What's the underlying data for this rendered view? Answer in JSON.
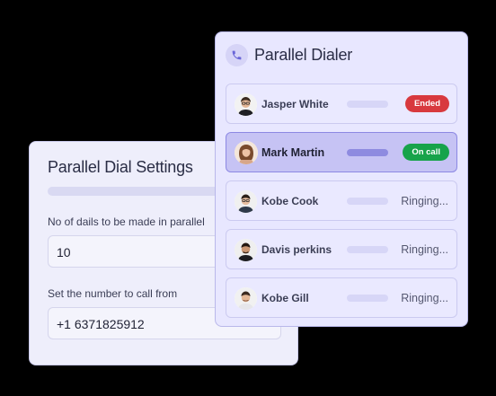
{
  "settings": {
    "title": "Parallel Dial Settings",
    "parallel_label": "No of dails to be made in parallel",
    "parallel_value": "10",
    "from_label": "Set the number to call from",
    "from_value": "+1 6371825912"
  },
  "dialer": {
    "title": "Parallel Dialer",
    "icon": "phone-icon",
    "calls": [
      {
        "name": "Jasper White",
        "status": "Ended",
        "status_kind": "pill",
        "status_color": "#d8393e",
        "active": false
      },
      {
        "name": "Mark Martin",
        "status": "On call",
        "status_kind": "pill",
        "status_color": "#17a34a",
        "active": true
      },
      {
        "name": "Kobe Cook",
        "status": "Ringing...",
        "status_kind": "text",
        "active": false
      },
      {
        "name": "Davis perkins",
        "status": "Ringing...",
        "status_kind": "text",
        "active": false
      },
      {
        "name": "Kobe Gill",
        "status": "Ringing...",
        "status_kind": "text",
        "active": false
      }
    ]
  },
  "colors": {
    "accent": "#7b78e0",
    "ended": "#d8393e",
    "on_call": "#17a34a"
  }
}
